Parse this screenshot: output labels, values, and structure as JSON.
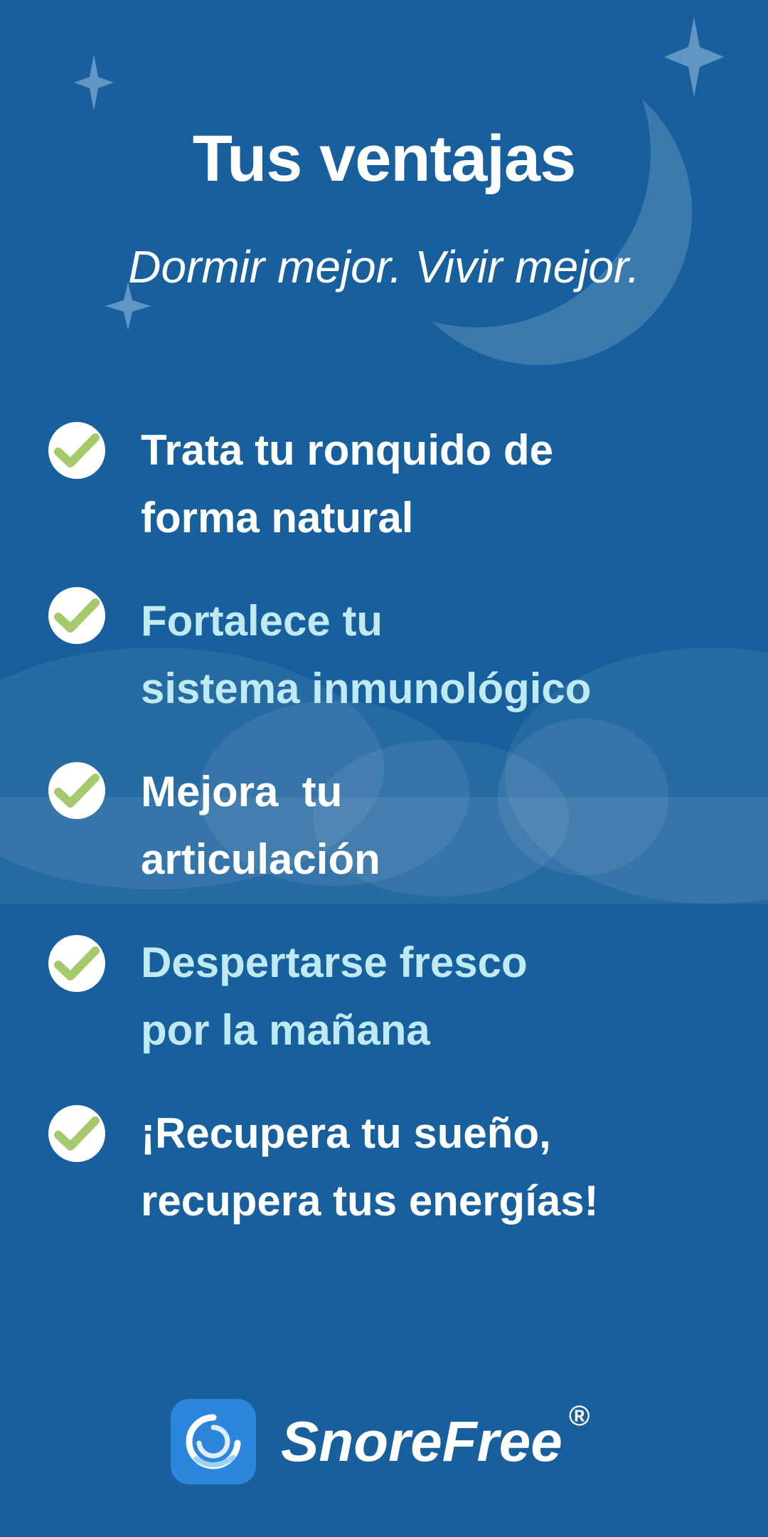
{
  "colors": {
    "background": "#17609d",
    "white_text": "#ffffff",
    "accent_text": "#bfeaf2",
    "check_circle": "#ffffff",
    "check_mark": "#a6c96c",
    "app_icon_bg": "#2b86dc"
  },
  "header": {
    "title": "Tus ventajas",
    "subtitle": "Dormir mejor. Vivir mejor."
  },
  "decorations": {
    "icons": [
      "moon-icon",
      "star-icon",
      "cloud-icon"
    ]
  },
  "benefits": [
    {
      "icon": "check-icon",
      "line1": "Trata tu ronquido de",
      "line2": "forma natural",
      "color": "#ffffff"
    },
    {
      "icon": "check-icon",
      "line1": "Fortalece tu",
      "line2": "sistema inmunológico",
      "color": "#bfeaf2"
    },
    {
      "icon": "check-icon",
      "line1": "Mejora  tu",
      "line2": "articulación",
      "color": "#ffffff"
    },
    {
      "icon": "check-icon",
      "line1": "Despertarse fresco",
      "line2": "por la mañana",
      "color": "#bfeaf2"
    },
    {
      "icon": "check-icon",
      "line1": "¡Recupera tu sueño,",
      "line2": "recupera tus energías!",
      "color": "#ffffff"
    }
  ],
  "brand": {
    "icon": "snorefree-app-icon",
    "name": "SnoreFree",
    "registered": "®"
  }
}
